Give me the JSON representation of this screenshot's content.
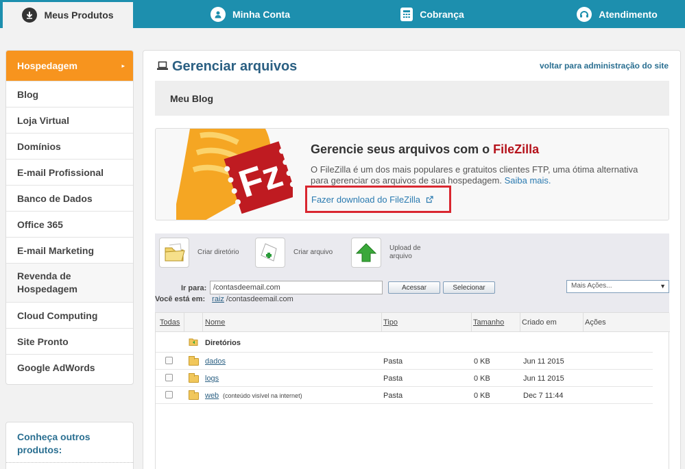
{
  "topnav": {
    "tabs": [
      {
        "label": "Meus Produtos",
        "icon": "download-icon",
        "active": true
      },
      {
        "label": "Minha Conta",
        "icon": "user-icon",
        "active": false
      },
      {
        "label": "Cobrança",
        "icon": "calculator-icon",
        "active": false
      },
      {
        "label": "Atendimento",
        "icon": "support-icon",
        "active": false
      }
    ]
  },
  "sidebar": {
    "items": [
      {
        "label": "Hospedagem",
        "active": true
      },
      {
        "label": "Blog"
      },
      {
        "label": "Loja Virtual"
      },
      {
        "label": "Domínios"
      },
      {
        "label": "E-mail Profissional"
      },
      {
        "label": "Banco de Dados"
      },
      {
        "label": "Office 365"
      },
      {
        "label": "E-mail Marketing"
      },
      {
        "label": "Revenda de Hospedagem"
      },
      {
        "label": "Cloud Computing"
      },
      {
        "label": "Site Pronto"
      },
      {
        "label": "Google AdWords"
      }
    ],
    "other_products": "Conheça outros produtos:"
  },
  "main": {
    "title": "Gerenciar arquivos",
    "back_link": "voltar para administração do site",
    "site_name": "Meu Blog",
    "promo": {
      "heading_prefix": "Gerencie seus arquivos com o",
      "heading_brand": "FileZilla",
      "description": "O FileZilla é um dos mais populares e gratuitos clientes FTP, uma ótima alternativa para gerenciar os arquivos de sua hospedagem.",
      "more_link": "Saiba mais.",
      "download_link": "Fazer download do FileZilla"
    },
    "toolbar": {
      "create_dir": "Criar diretório",
      "create_file": "Criar arquivo",
      "upload": "Upload de arquivo",
      "go_to_label": "Ir para:",
      "path_value": "/contasdeemail.com",
      "access_button": "Acessar",
      "select_button": "Selecionar",
      "more_actions": "Mais Ações...",
      "location_label": "Você está em:",
      "location_root": "raiz",
      "location_path": "/contasdeemail.com"
    },
    "table": {
      "headers": {
        "all": "Todas",
        "name": "Nome",
        "type": "Tipo",
        "size": "Tamanho",
        "created": "Criado em",
        "actions": "Ações"
      },
      "section_label": "Diretórios",
      "rows": [
        {
          "name": "dados",
          "note": "",
          "type": "Pasta",
          "size": "0 KB",
          "created": "Jun 11 2015"
        },
        {
          "name": "logs",
          "note": "",
          "type": "Pasta",
          "size": "0 KB",
          "created": "Jun 11 2015"
        },
        {
          "name": "web",
          "note": "(conteúdo visível na internet)",
          "type": "Pasta",
          "size": "0 KB",
          "created": "Dec 7 11:44"
        }
      ]
    }
  },
  "colors": {
    "nav_blue": "#1d8fae",
    "orange": "#f7941e",
    "title_blue": "#2a5f82",
    "highlight_red": "#d9262f",
    "filezilla_red": "#b5121b"
  }
}
